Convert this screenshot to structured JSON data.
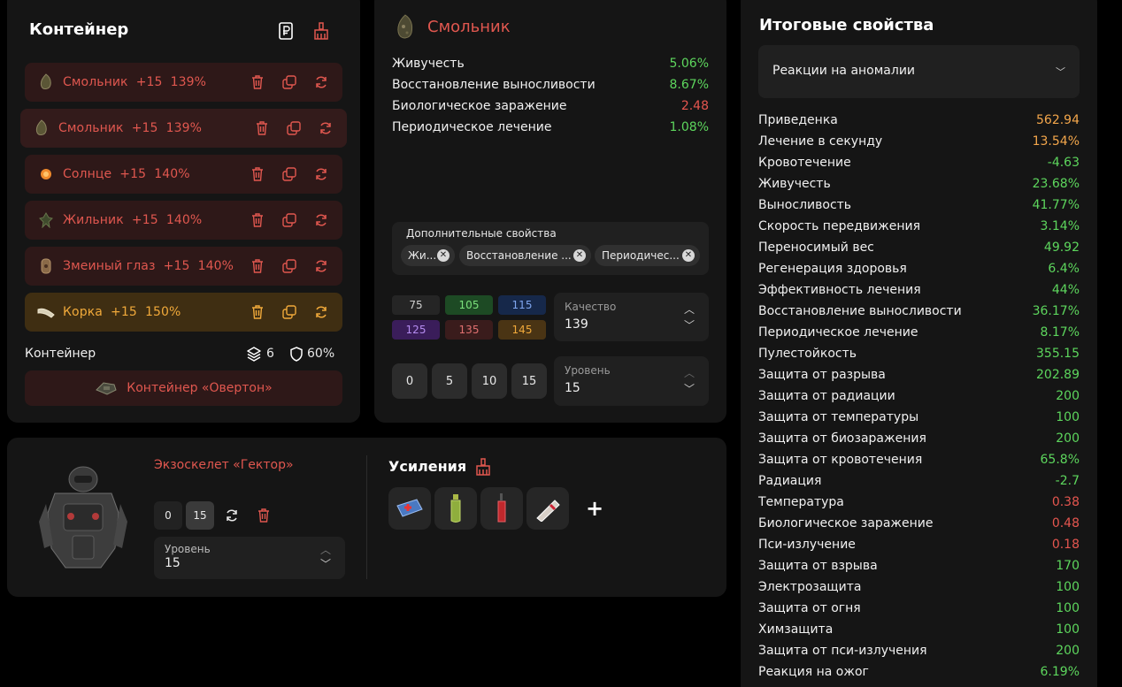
{
  "container_panel": {
    "title": "Контейнер",
    "items": [
      {
        "text": "Смольник  +15  139%",
        "icon": "smolnik-artifact-icon"
      },
      {
        "text": "Смольник  +15  139%",
        "icon": "smolnik-artifact-icon"
      },
      {
        "text": "Солнце  +15  140%",
        "icon": "sun-artifact-icon"
      },
      {
        "text": "Жильник  +15  140%",
        "icon": "zhilnik-artifact-icon"
      },
      {
        "text": "Змеиный глаз  +15  140%",
        "icon": "snake-eye-artifact-icon"
      },
      {
        "text": "Корка  +15  150%",
        "icon": "crust-artifact-icon"
      }
    ],
    "footer_label": "Контейнер",
    "slots": "6",
    "protection": "60%",
    "container_name": "Контейнер «Овертон»"
  },
  "artifact_panel": {
    "name": "Смольник",
    "stats": [
      {
        "label": "Живучесть",
        "value": "5.06%",
        "color": "green"
      },
      {
        "label": "Восстановление выносливости",
        "value": "8.67%",
        "color": "green"
      },
      {
        "label": "Биологическое заражение",
        "value": "2.48",
        "color": "red"
      },
      {
        "label": "Периодическое лечение",
        "value": "1.08%",
        "color": "green"
      }
    ],
    "extra_label": "Дополнительные свойства",
    "chips": [
      "Жи...",
      "Восстановление ...",
      "Периодичес..."
    ],
    "quality_presets": [
      "75",
      "105",
      "115",
      "125",
      "135",
      "145"
    ],
    "quality_label": "Качество",
    "quality_value": "139",
    "level_presets": [
      "0",
      "5",
      "10",
      "15"
    ],
    "level_label": "Уровень",
    "level_value": "15"
  },
  "armor_panel": {
    "name": "Экзоскелет «Гектор»",
    "level_buttons": [
      "0",
      "15"
    ],
    "level_label": "Уровень",
    "level_value": "15",
    "boosters_title": "Усиления",
    "add_symbol": "+"
  },
  "totals_panel": {
    "title": "Итоговые свойства",
    "filter": "Реакции на аномалии",
    "stats": [
      {
        "label": "Приведенка",
        "value": "562.94",
        "color": "orange"
      },
      {
        "label": "Лечение в секунду",
        "value": "13.54%",
        "color": "orange"
      },
      {
        "label": "Кровотечение",
        "value": "-4.63",
        "color": "green"
      },
      {
        "label": "Живучесть",
        "value": "23.68%",
        "color": "green"
      },
      {
        "label": "Выносливость",
        "value": "41.77%",
        "color": "green"
      },
      {
        "label": "Скорость передвижения",
        "value": "3.14%",
        "color": "green"
      },
      {
        "label": "Переносимый вес",
        "value": "49.92",
        "color": "green"
      },
      {
        "label": "Регенерация здоровья",
        "value": "6.4%",
        "color": "green"
      },
      {
        "label": "Эффективность лечения",
        "value": "44%",
        "color": "green"
      },
      {
        "label": "Восстановление выносливости",
        "value": "36.17%",
        "color": "green"
      },
      {
        "label": "Периодическое лечение",
        "value": "8.17%",
        "color": "green"
      },
      {
        "label": "Пулестойкость",
        "value": "355.15",
        "color": "green"
      },
      {
        "label": "Защита от разрыва",
        "value": "202.89",
        "color": "green"
      },
      {
        "label": "Защита от радиации",
        "value": "200",
        "color": "green"
      },
      {
        "label": "Защита от температуры",
        "value": "100",
        "color": "green"
      },
      {
        "label": "Защита от биозаражения",
        "value": "200",
        "color": "green"
      },
      {
        "label": "Защита от кровотечения",
        "value": "65.8%",
        "color": "green"
      },
      {
        "label": "Радиация",
        "value": "-2.7",
        "color": "green"
      },
      {
        "label": "Температура",
        "value": "0.38",
        "color": "red"
      },
      {
        "label": "Биологическое заражение",
        "value": "0.48",
        "color": "red"
      },
      {
        "label": "Пси-излучение",
        "value": "0.18",
        "color": "red"
      },
      {
        "label": "Защита от взрыва",
        "value": "170",
        "color": "green"
      },
      {
        "label": "Электрозащита",
        "value": "100",
        "color": "green"
      },
      {
        "label": "Защита от огня",
        "value": "100",
        "color": "green"
      },
      {
        "label": "Химзащита",
        "value": "100",
        "color": "green"
      },
      {
        "label": "Защита от пси-излучения",
        "value": "200",
        "color": "green"
      },
      {
        "label": "Реакция на ожог",
        "value": "6.19%",
        "color": "green"
      }
    ]
  },
  "colors": {
    "accent_red": "#e0574f",
    "accent_gold": "#f0a93a",
    "positive": "#5dd65d",
    "panel": "#151515"
  }
}
